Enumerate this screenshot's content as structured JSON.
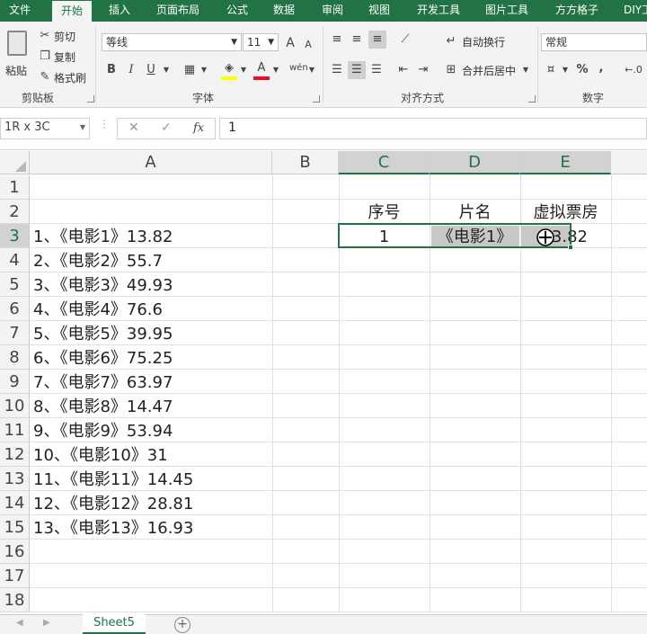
{
  "tabs": [
    "文件",
    "开始",
    "插入",
    "页面布局",
    "公式",
    "数据",
    "审阅",
    "视图",
    "开发工具",
    "图片工具",
    "方方格子",
    "DIY工具箱"
  ],
  "clipboard": {
    "paste": "粘贴",
    "cut": "剪切",
    "copy": "复制",
    "format_painter": "格式刷",
    "group": "剪贴板"
  },
  "font": {
    "name": "等线",
    "size": "11",
    "bold": "B",
    "italic": "I",
    "underline": "U",
    "grow": "A",
    "shrink": "A",
    "font_color_letter": "A",
    "phonetic": "wén",
    "group": "字体"
  },
  "alignment": {
    "wrap": "自动换行",
    "merge": "合并后居中",
    "group": "对齐方式"
  },
  "number": {
    "format": "常规",
    "percent": "%",
    "comma": ",",
    "group": "数字"
  },
  "formula_bar": {
    "namebox": "1R x 3C",
    "cancel": "✕",
    "enter": "✓",
    "fx": "fx",
    "value": "1"
  },
  "columns": [
    "A",
    "B",
    "C",
    "D",
    "E"
  ],
  "rows": [
    "1",
    "2",
    "3",
    "4",
    "5",
    "6",
    "7",
    "8",
    "9",
    "10",
    "11",
    "12",
    "13",
    "14",
    "15",
    "16",
    "17",
    "18"
  ],
  "col_a": [
    "1、《电影1》13.82",
    "2、《电影2》55.7",
    "3、《电影3》49.93",
    "4、《电影4》76.6",
    "5、《电影5》39.95",
    "6、《电影6》75.25",
    "7、《电影7》63.97",
    "8、《电影8》14.47",
    "9、《电影9》53.94",
    "10、《电影10》31",
    "11、《电影11》14.45",
    "12、《电影12》28.81",
    "13、《电影13》16.93"
  ],
  "table": {
    "headers": [
      "序号",
      "片名",
      "虚拟票房"
    ],
    "row": [
      "1",
      "《电影1》",
      "13.82"
    ]
  },
  "sheet_tab": "Sheet5",
  "add_sheet": "+",
  "colors": {
    "accent": "#217346",
    "selection": "#d2d2d2"
  }
}
